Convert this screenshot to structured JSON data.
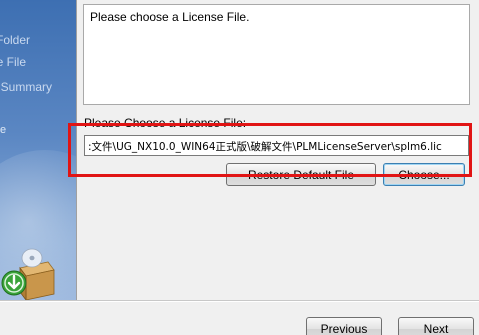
{
  "sidebar": {
    "steps": [
      {
        "label": "Folder"
      },
      {
        "label": "e File"
      },
      {
        "label": "Summary"
      }
    ],
    "bullet_glyph": "e"
  },
  "message": {
    "text": "Please choose a License File."
  },
  "license": {
    "label": "Please Choose a License File:",
    "path": ":文件\\UG_NX10.0_WIN64正式版\\破解文件\\PLMLicenseServer\\splm6.lic"
  },
  "buttons": {
    "restore_label": "Restore Default File",
    "choose_label": "Choose...",
    "previous_label": "Previous",
    "next_label": "Next"
  },
  "colors": {
    "highlight": "#e11414",
    "sidebar_top": "#3d6fb2",
    "sidebar_bottom": "#9cb8de",
    "focus_border": "#3c7fb1"
  },
  "icons": {
    "installer_box": "package-box-icon",
    "download_arrow": "download-arrow-icon",
    "cd": "cd-disc-icon"
  }
}
